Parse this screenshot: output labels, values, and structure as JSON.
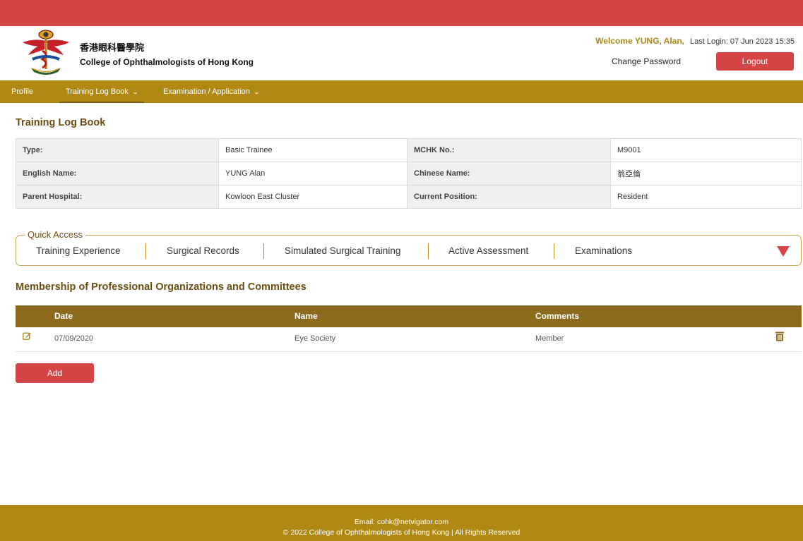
{
  "header": {
    "college_name_zh": "香港眼科醫學院",
    "college_name_en": "College of Ophthalmologists of Hong Kong",
    "welcome": "Welcome YUNG, Alan,",
    "last_login": "Last Login: 07 Jun 2023 15:35",
    "change_password": "Change Password",
    "logout": "Logout"
  },
  "nav": {
    "items": [
      {
        "label": "Profile"
      },
      {
        "label": "Training Log Book"
      },
      {
        "label": "Examination / Application"
      }
    ]
  },
  "page_title": "Training Log Book",
  "info": {
    "type_label": "Type:",
    "type_value": "Basic Trainee",
    "mchk_label": "MCHK No.:",
    "mchk_value": "M9001",
    "english_name_label": "English Name:",
    "english_name_value": "YUNG Alan",
    "chinese_name_label": "Chinese Name:",
    "chinese_name_value": "翁亞倫",
    "parent_hospital_label": "Parent Hospital:",
    "parent_hospital_value": "Kowloon East Cluster",
    "current_position_label": "Current Position:",
    "current_position_value": "Resident"
  },
  "quick_access": {
    "legend": "Quick Access",
    "items": [
      {
        "label": "Training Experience"
      },
      {
        "label": "Surgical Records"
      },
      {
        "label": "Simulated Surgical Training"
      },
      {
        "label": "Active Assessment"
      },
      {
        "label": "Examinations"
      }
    ]
  },
  "membership": {
    "title": "Membership of Professional Organizations and Committees",
    "columns": [
      "Date",
      "Name",
      "Comments"
    ],
    "rows": [
      {
        "date": "07/09/2020",
        "name": "Eye Society",
        "comments": "Member"
      }
    ],
    "add_label": "Add"
  },
  "footer": {
    "email": "Email: cohk@netvigator.com",
    "copyright": "© 2022 College of Ophthalmologists of Hong Kong | All Rights Reserved"
  },
  "colors": {
    "accent_red": "#d64545",
    "gold": "#b08915",
    "table_header_brown": "#8c6a1e",
    "heading_brown": "#6b4e12"
  },
  "icons": [
    "college-logo",
    "chevron-down-icon",
    "triangle-down-icon",
    "edit-icon",
    "trash-icon"
  ]
}
